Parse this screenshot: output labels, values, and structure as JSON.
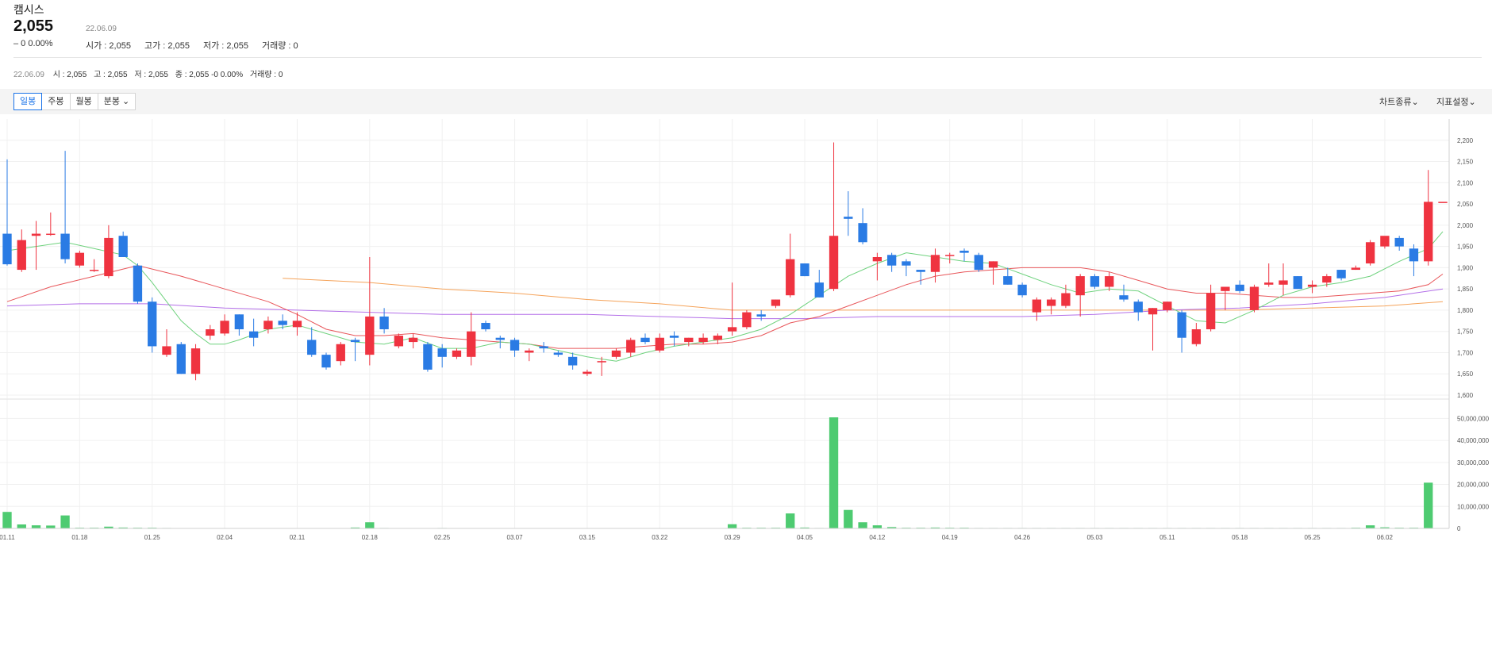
{
  "stock": {
    "name": "캠시스",
    "price": "2,055",
    "date": "22.06.09",
    "change": "– 0 0.00%",
    "open": "시가 : 2,055",
    "high": "고가 : 2,055",
    "low": "저가 : 2,055",
    "volume": "거래량 : 0"
  },
  "info_line": {
    "date": "22.06.09",
    "open": "시 : 2,055",
    "high": "고 : 2,055",
    "low": "저 : 2,055",
    "close": "종 : 2,055 -0 0.00%",
    "volume": "거래량 : 0"
  },
  "toolbar": {
    "tabs": [
      "일봉",
      "주봉",
      "월봉",
      "분봉"
    ],
    "active_tab": "일봉",
    "chart_type_label": "차트종류",
    "indicator_label": "지표설정"
  },
  "colors": {
    "up": "#ef3340",
    "down": "#2a7be4",
    "volume": "#4ecb71",
    "ma5": "#6fd27e",
    "ma20": "#e8565a",
    "ma60": "#b36fe8",
    "ma120": "#f5a35a"
  },
  "chart_data": {
    "type": "candlestick",
    "scale_label": "Linear",
    "ylim": [
      1600,
      2250
    ],
    "price_ticks": [
      1600,
      1650,
      1700,
      1750,
      1800,
      1850,
      1900,
      1950,
      2000,
      2050,
      2100,
      2150,
      2200
    ],
    "price_tick_labels": [
      "1,600",
      "1,650",
      "1,700",
      "1,750",
      "1,800",
      "1,850",
      "1,900",
      "1,950",
      "2,000",
      "2,050",
      "2,100",
      "2,150",
      "2,200"
    ],
    "volume_ylim": [
      0,
      57000000
    ],
    "volume_ticks": [
      0,
      10000000,
      20000000,
      30000000,
      40000000,
      50000000
    ],
    "volume_tick_labels": [
      "0",
      "10,000,000",
      "20,000,000",
      "30,000,000",
      "40,000,000",
      "50,000,000"
    ],
    "x_labels": [
      {
        "i": 0,
        "label": "01.11"
      },
      {
        "i": 5,
        "label": "01.18"
      },
      {
        "i": 10,
        "label": "01.25"
      },
      {
        "i": 15,
        "label": "02.04"
      },
      {
        "i": 20,
        "label": "02.11"
      },
      {
        "i": 25,
        "label": "02.18"
      },
      {
        "i": 30,
        "label": "02.25"
      },
      {
        "i": 35,
        "label": "03.07"
      },
      {
        "i": 40,
        "label": "03.15"
      },
      {
        "i": 45,
        "label": "03.22"
      },
      {
        "i": 50,
        "label": "03.29"
      },
      {
        "i": 55,
        "label": "04.05"
      },
      {
        "i": 60,
        "label": "04.12"
      },
      {
        "i": 65,
        "label": "04.19"
      },
      {
        "i": 70,
        "label": "04.26"
      },
      {
        "i": 75,
        "label": "05.03"
      },
      {
        "i": 80,
        "label": "05.11"
      },
      {
        "i": 85,
        "label": "05.18"
      },
      {
        "i": 90,
        "label": "05.25"
      },
      {
        "i": 95,
        "label": "06.02"
      }
    ],
    "candles": [
      [
        1980,
        2155,
        1905,
        1908
      ],
      [
        1895,
        1990,
        1890,
        1965
      ],
      [
        1975,
        2010,
        1895,
        1980
      ],
      [
        1980,
        2030,
        1975,
        1980
      ],
      [
        1980,
        2175,
        1910,
        1920
      ],
      [
        1905,
        1940,
        1900,
        1935
      ],
      [
        1895,
        1920,
        1890,
        1895
      ],
      [
        1880,
        2000,
        1875,
        1970
      ],
      [
        1975,
        1985,
        1925,
        1925
      ],
      [
        1905,
        1910,
        1815,
        1820
      ],
      [
        1820,
        1830,
        1700,
        1715
      ],
      [
        1695,
        1755,
        1690,
        1715
      ],
      [
        1720,
        1725,
        1650,
        1650
      ],
      [
        1650,
        1720,
        1635,
        1710
      ],
      [
        1740,
        1765,
        1730,
        1755
      ],
      [
        1745,
        1790,
        1740,
        1775
      ],
      [
        1790,
        1790,
        1740,
        1755
      ],
      [
        1750,
        1780,
        1715,
        1735
      ],
      [
        1755,
        1785,
        1745,
        1775
      ],
      [
        1775,
        1790,
        1755,
        1765
      ],
      [
        1760,
        1795,
        1740,
        1775
      ],
      [
        1730,
        1760,
        1690,
        1695
      ],
      [
        1695,
        1700,
        1660,
        1665
      ],
      [
        1680,
        1725,
        1670,
        1720
      ],
      [
        1730,
        1735,
        1680,
        1725
      ],
      [
        1695,
        1925,
        1670,
        1785
      ],
      [
        1785,
        1805,
        1745,
        1755
      ],
      [
        1715,
        1745,
        1710,
        1740
      ],
      [
        1725,
        1745,
        1710,
        1735
      ],
      [
        1720,
        1725,
        1655,
        1660
      ],
      [
        1710,
        1720,
        1665,
        1690
      ],
      [
        1690,
        1710,
        1685,
        1705
      ],
      [
        1690,
        1795,
        1670,
        1750
      ],
      [
        1770,
        1775,
        1750,
        1755
      ],
      [
        1735,
        1740,
        1710,
        1730
      ],
      [
        1730,
        1735,
        1690,
        1705
      ],
      [
        1700,
        1710,
        1680,
        1705
      ],
      [
        1715,
        1725,
        1700,
        1710
      ],
      [
        1700,
        1705,
        1690,
        1695
      ],
      [
        1690,
        1700,
        1660,
        1670
      ],
      [
        1650,
        1660,
        1645,
        1655
      ],
      [
        1680,
        1690,
        1645,
        1680
      ],
      [
        1690,
        1710,
        1685,
        1705
      ],
      [
        1700,
        1735,
        1690,
        1730
      ],
      [
        1735,
        1745,
        1720,
        1725
      ],
      [
        1705,
        1745,
        1700,
        1735
      ],
      [
        1740,
        1750,
        1715,
        1735
      ],
      [
        1725,
        1735,
        1715,
        1735
      ],
      [
        1725,
        1745,
        1720,
        1735
      ],
      [
        1730,
        1745,
        1720,
        1740
      ],
      [
        1750,
        1865,
        1740,
        1760
      ],
      [
        1760,
        1800,
        1755,
        1795
      ],
      [
        1790,
        1800,
        1775,
        1785
      ],
      [
        1810,
        1825,
        1805,
        1825
      ],
      [
        1835,
        1980,
        1830,
        1920
      ],
      [
        1910,
        1910,
        1880,
        1880
      ],
      [
        1865,
        1895,
        1830,
        1830
      ],
      [
        1850,
        2195,
        1845,
        1975
      ],
      [
        2020,
        2080,
        1975,
        2015
      ],
      [
        2005,
        2040,
        1955,
        1960
      ],
      [
        1915,
        1935,
        1870,
        1925
      ],
      [
        1930,
        1935,
        1890,
        1905
      ],
      [
        1915,
        1920,
        1880,
        1905
      ],
      [
        1895,
        1895,
        1860,
        1890
      ],
      [
        1890,
        1945,
        1865,
        1930
      ],
      [
        1930,
        1935,
        1910,
        1930
      ],
      [
        1940,
        1945,
        1915,
        1935
      ],
      [
        1930,
        1935,
        1890,
        1895
      ],
      [
        1900,
        1915,
        1860,
        1915
      ],
      [
        1880,
        1900,
        1860,
        1860
      ],
      [
        1860,
        1865,
        1830,
        1835
      ],
      [
        1795,
        1830,
        1775,
        1825
      ],
      [
        1810,
        1830,
        1790,
        1825
      ],
      [
        1810,
        1860,
        1805,
        1840
      ],
      [
        1835,
        1885,
        1785,
        1880
      ],
      [
        1880,
        1885,
        1850,
        1855
      ],
      [
        1855,
        1890,
        1845,
        1880
      ],
      [
        1835,
        1860,
        1820,
        1825
      ],
      [
        1820,
        1825,
        1775,
        1795
      ],
      [
        1790,
        1805,
        1705,
        1805
      ],
      [
        1800,
        1820,
        1795,
        1820
      ],
      [
        1795,
        1800,
        1700,
        1735
      ],
      [
        1720,
        1770,
        1715,
        1755
      ],
      [
        1755,
        1860,
        1750,
        1840
      ],
      [
        1845,
        1850,
        1800,
        1855
      ],
      [
        1860,
        1870,
        1840,
        1845
      ],
      [
        1800,
        1860,
        1795,
        1855
      ],
      [
        1860,
        1910,
        1855,
        1865
      ],
      [
        1860,
        1910,
        1835,
        1870
      ],
      [
        1880,
        1880,
        1850,
        1850
      ],
      [
        1855,
        1870,
        1840,
        1860
      ],
      [
        1865,
        1885,
        1855,
        1880
      ],
      [
        1895,
        1895,
        1870,
        1875
      ],
      [
        1895,
        1905,
        1895,
        1900
      ],
      [
        1910,
        1965,
        1905,
        1960
      ],
      [
        1950,
        1970,
        1945,
        1975
      ],
      [
        1970,
        1975,
        1940,
        1950
      ],
      [
        1945,
        1955,
        1880,
        1915
      ],
      [
        1915,
        2130,
        1905,
        2055
      ],
      [
        2055,
        2055,
        2055,
        2055
      ]
    ],
    "volume": [
      7500000,
      1800000,
      1400000,
      1300000,
      5900000,
      300000,
      300000,
      800000,
      400000,
      300000,
      300000,
      200000,
      100000,
      100000,
      100000,
      100000,
      100000,
      100000,
      100000,
      100000,
      100000,
      100000,
      100000,
      100000,
      400000,
      2800000,
      200000,
      100000,
      100000,
      100000,
      200000,
      100000,
      100000,
      100000,
      100000,
      100000,
      100000,
      100000,
      100000,
      100000,
      100000,
      100000,
      100000,
      100000,
      100000,
      100000,
      100000,
      100000,
      100000,
      100000,
      1900000,
      300000,
      300000,
      300000,
      6800000,
      400000,
      200000,
      50500000,
      8400000,
      2800000,
      1400000,
      600000,
      300000,
      300000,
      400000,
      300000,
      300000,
      200000,
      200000,
      200000,
      200000,
      200000,
      200000,
      200000,
      200000,
      200000,
      200000,
      200000,
      200000,
      200000,
      200000,
      200000,
      200000,
      200000,
      200000,
      200000,
      200000,
      200000,
      200000,
      200000,
      200000,
      200000,
      200000,
      300000,
      1400000,
      500000,
      300000,
      300000,
      20800000,
      0
    ],
    "ma5": [
      [
        0,
        1940
      ],
      [
        2,
        1950
      ],
      [
        4,
        1960
      ],
      [
        6,
        1945
      ],
      [
        8,
        1930
      ],
      [
        9,
        1905
      ],
      [
        10,
        1865
      ],
      [
        11,
        1820
      ],
      [
        12,
        1775
      ],
      [
        13,
        1745
      ],
      [
        14,
        1720
      ],
      [
        15,
        1720
      ],
      [
        16,
        1730
      ],
      [
        18,
        1755
      ],
      [
        20,
        1765
      ],
      [
        22,
        1745
      ],
      [
        24,
        1725
      ],
      [
        26,
        1720
      ],
      [
        28,
        1735
      ],
      [
        30,
        1710
      ],
      [
        32,
        1710
      ],
      [
        34,
        1725
      ],
      [
        36,
        1720
      ],
      [
        38,
        1705
      ],
      [
        40,
        1690
      ],
      [
        42,
        1680
      ],
      [
        44,
        1700
      ],
      [
        46,
        1715
      ],
      [
        48,
        1725
      ],
      [
        50,
        1735
      ],
      [
        52,
        1755
      ],
      [
        54,
        1790
      ],
      [
        56,
        1835
      ],
      [
        58,
        1880
      ],
      [
        60,
        1910
      ],
      [
        62,
        1935
      ],
      [
        64,
        1925
      ],
      [
        66,
        1915
      ],
      [
        68,
        1910
      ],
      [
        70,
        1885
      ],
      [
        72,
        1860
      ],
      [
        74,
        1840
      ],
      [
        76,
        1850
      ],
      [
        78,
        1845
      ],
      [
        80,
        1810
      ],
      [
        82,
        1775
      ],
      [
        84,
        1770
      ],
      [
        86,
        1800
      ],
      [
        88,
        1835
      ],
      [
        90,
        1855
      ],
      [
        92,
        1865
      ],
      [
        94,
        1880
      ],
      [
        96,
        1915
      ],
      [
        98,
        1945
      ],
      [
        99,
        1985
      ]
    ],
    "ma20": [
      [
        0,
        1820
      ],
      [
        3,
        1855
      ],
      [
        6,
        1880
      ],
      [
        9,
        1905
      ],
      [
        12,
        1880
      ],
      [
        15,
        1850
      ],
      [
        18,
        1820
      ],
      [
        20,
        1790
      ],
      [
        22,
        1755
      ],
      [
        24,
        1740
      ],
      [
        26,
        1740
      ],
      [
        28,
        1745
      ],
      [
        30,
        1735
      ],
      [
        32,
        1730
      ],
      [
        34,
        1725
      ],
      [
        36,
        1720
      ],
      [
        38,
        1710
      ],
      [
        40,
        1710
      ],
      [
        42,
        1710
      ],
      [
        44,
        1715
      ],
      [
        46,
        1720
      ],
      [
        48,
        1720
      ],
      [
        50,
        1725
      ],
      [
        52,
        1740
      ],
      [
        54,
        1770
      ],
      [
        56,
        1785
      ],
      [
        58,
        1810
      ],
      [
        60,
        1835
      ],
      [
        62,
        1860
      ],
      [
        64,
        1880
      ],
      [
        66,
        1890
      ],
      [
        68,
        1895
      ],
      [
        70,
        1900
      ],
      [
        72,
        1900
      ],
      [
        74,
        1900
      ],
      [
        76,
        1890
      ],
      [
        78,
        1870
      ],
      [
        80,
        1850
      ],
      [
        82,
        1840
      ],
      [
        84,
        1840
      ],
      [
        86,
        1835
      ],
      [
        88,
        1830
      ],
      [
        90,
        1830
      ],
      [
        92,
        1835
      ],
      [
        94,
        1840
      ],
      [
        96,
        1845
      ],
      [
        98,
        1860
      ],
      [
        99,
        1885
      ]
    ],
    "ma60": [
      [
        0,
        1810
      ],
      [
        5,
        1815
      ],
      [
        10,
        1815
      ],
      [
        15,
        1805
      ],
      [
        20,
        1800
      ],
      [
        25,
        1795
      ],
      [
        30,
        1790
      ],
      [
        35,
        1790
      ],
      [
        40,
        1790
      ],
      [
        45,
        1785
      ],
      [
        50,
        1780
      ],
      [
        55,
        1780
      ],
      [
        60,
        1785
      ],
      [
        65,
        1785
      ],
      [
        70,
        1785
      ],
      [
        75,
        1790
      ],
      [
        80,
        1800
      ],
      [
        85,
        1805
      ],
      [
        90,
        1815
      ],
      [
        95,
        1830
      ],
      [
        99,
        1850
      ]
    ],
    "ma120": [
      [
        19,
        1875
      ],
      [
        25,
        1865
      ],
      [
        30,
        1850
      ],
      [
        35,
        1840
      ],
      [
        40,
        1825
      ],
      [
        45,
        1815
      ],
      [
        50,
        1800
      ],
      [
        55,
        1800
      ],
      [
        60,
        1800
      ],
      [
        65,
        1800
      ],
      [
        70,
        1800
      ],
      [
        75,
        1800
      ],
      [
        80,
        1800
      ],
      [
        85,
        1800
      ],
      [
        90,
        1805
      ],
      [
        95,
        1810
      ],
      [
        99,
        1820
      ]
    ]
  }
}
